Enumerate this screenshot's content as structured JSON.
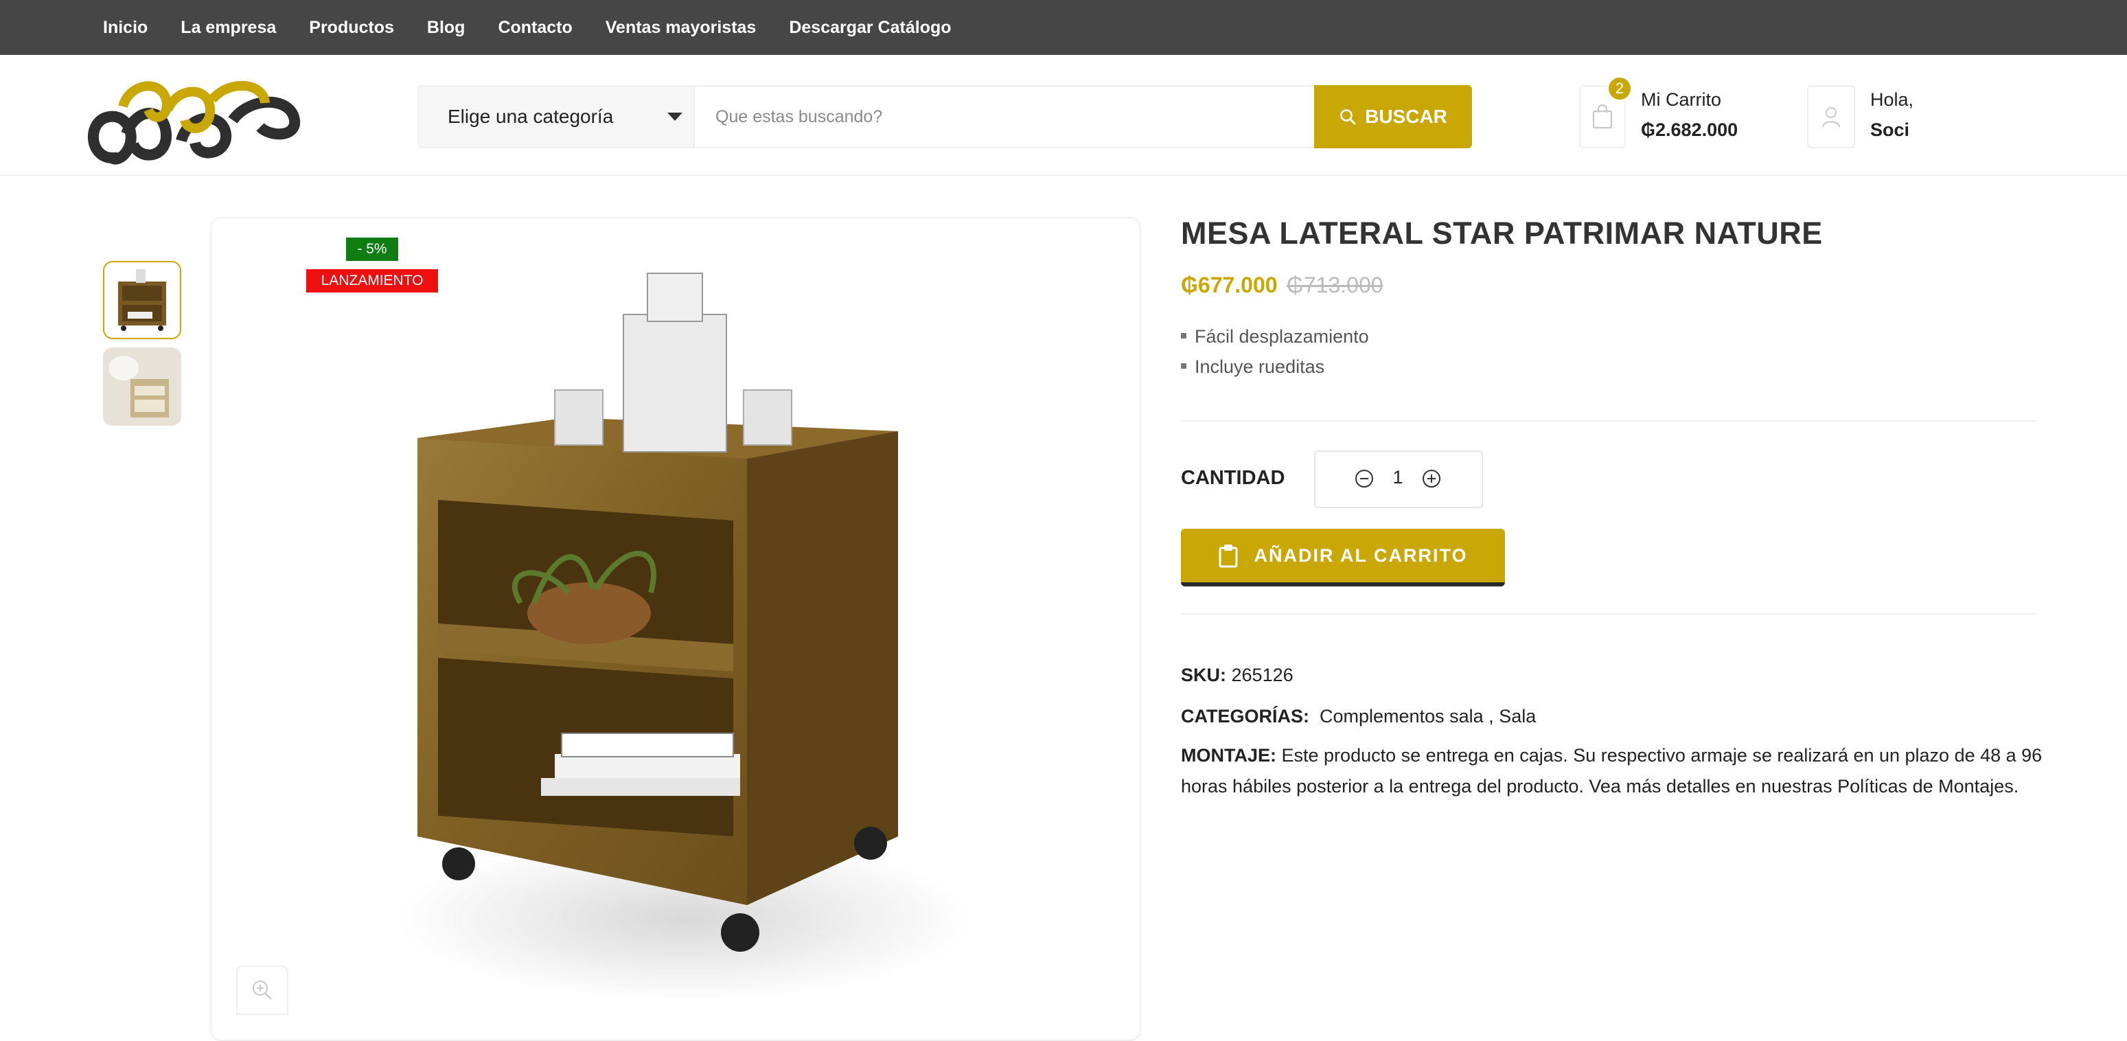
{
  "top_nav": {
    "items": [
      {
        "label": "Inicio"
      },
      {
        "label": "La empresa"
      },
      {
        "label": "Productos"
      },
      {
        "label": "Blog"
      },
      {
        "label": "Contacto"
      },
      {
        "label": "Ventas mayoristas"
      },
      {
        "label": "Descargar Catálogo"
      }
    ]
  },
  "header": {
    "category_select": {
      "value": "Elige una categoría"
    },
    "search": {
      "placeholder": "Que estas buscando?",
      "value": "",
      "button_label": "BUSCAR"
    },
    "cart": {
      "count": "2",
      "title": "Mi Carrito",
      "total": "₲2.682.000"
    },
    "account": {
      "greeting": "Hola,",
      "name": "Soci"
    }
  },
  "product": {
    "badges": {
      "discount": "- 5%",
      "launch": "LANZAMIENTO"
    },
    "title": "MESA LATERAL STAR PATRIMAR NATURE",
    "price_current": "₲677.000",
    "price_old": "₲713.000",
    "features": [
      "Fácil desplazamiento",
      "Incluye rueditas"
    ],
    "quantity_label": "CANTIDAD",
    "quantity": "1",
    "add_to_cart_label": "AÑADIR AL CARRITO",
    "sku_label": "SKU:",
    "sku": "265126",
    "categories_label": "CATEGORÍAS:",
    "categories": [
      "Complementos sala",
      "Sala"
    ],
    "categories_sep": ",",
    "montaje_label": "MONTAJE:",
    "montaje_text": "Este producto se entrega en cajas. Su respectivo armaje se realizará en un plazo de 48 a 96 horas hábiles posterior a la entrega del producto. Vea más detalles en nuestras Políticas de Montajes."
  },
  "colors": {
    "accent": "#c9a806",
    "topbar": "#464646",
    "discount_badge": "#0f7d12",
    "launch_badge": "#ee1010"
  },
  "icons": {
    "search_button": "search-icon",
    "cart": "shopping-bag-icon",
    "account": "user-icon",
    "dropdown": "chevron-down-icon",
    "zoom": "zoom-in-icon",
    "qty_minus": "minus-circle-icon",
    "qty_plus": "plus-circle-icon",
    "add_to_cart": "clipboard-bag-icon"
  }
}
